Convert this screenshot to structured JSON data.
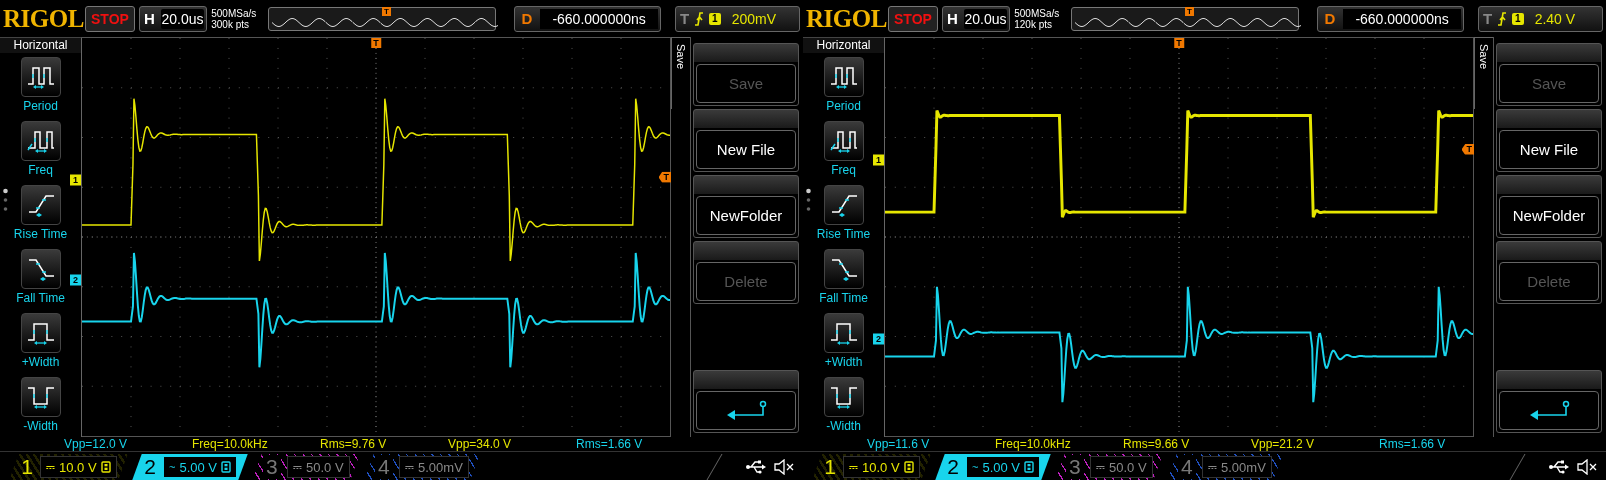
{
  "scopes": [
    {
      "logo": "RIGOL",
      "run_state": "STOP",
      "timebase": {
        "label": "H",
        "value": "20.0us"
      },
      "sample_rate": "500MSa/s",
      "memory_depth": "300k pts",
      "delay": {
        "label": "D",
        "value": "-660.000000ns"
      },
      "trigger": {
        "label": "T",
        "source": "1",
        "level": "200mV"
      },
      "sidebar": {
        "title": "Horizontal",
        "items": [
          {
            "label": "Period",
            "kind": "period"
          },
          {
            "label": "Freq",
            "kind": "freq"
          },
          {
            "label": "Rise Time",
            "kind": "rise"
          },
          {
            "label": "Fall Time",
            "kind": "fall"
          },
          {
            "label": "+Width",
            "kind": "pwidth"
          },
          {
            "label": "-Width",
            "kind": "nwidth"
          }
        ]
      },
      "trigger_markers": {
        "memory": "T",
        "position": "T",
        "level": "T"
      },
      "traces": [
        {
          "marker": "1",
          "kind": "ringing",
          "color": "#e6e600"
        },
        {
          "marker": "2",
          "kind": "spike",
          "color": "#18d4ec"
        }
      ],
      "menu": {
        "title": "Save",
        "buttons": [
          {
            "kind": "text",
            "label": "Save",
            "disabled": true
          },
          {
            "kind": "text",
            "label": "New File",
            "disabled": false
          },
          {
            "kind": "text",
            "label": "NewFolder",
            "disabled": false
          },
          {
            "kind": "text",
            "label": "Delete",
            "disabled": true
          },
          {
            "kind": "back"
          }
        ]
      },
      "measurements": [
        {
          "text": "Vpp=12.0 V",
          "color": "#18d4ec"
        },
        {
          "text": "Freq=10.0kHz",
          "color": "#e6e600"
        },
        {
          "text": "Rms=9.76 V",
          "color": "#e6e600"
        },
        {
          "text": "Vpp=34.0 V",
          "color": "#e6e600"
        },
        {
          "text": "Rms=1.66 V",
          "color": "#18d4ec"
        }
      ],
      "channels": [
        {
          "number": "1",
          "coupling": "⎓",
          "scale": "10.0 V",
          "color": "#e6e600",
          "enabled": true,
          "selected": false
        },
        {
          "number": "2",
          "coupling": "~",
          "scale": "5.00 V",
          "color": "#18d4ec",
          "enabled": true,
          "selected": true
        },
        {
          "number": "3",
          "coupling": "⎓",
          "scale": "50.0 V",
          "color": "#c020c0",
          "enabled": false,
          "selected": false
        },
        {
          "number": "4",
          "coupling": "⎓",
          "scale": "5.00mV",
          "color": "#2050c0",
          "enabled": false,
          "selected": false
        }
      ]
    },
    {
      "logo": "RIGOL",
      "run_state": "STOP",
      "timebase": {
        "label": "H",
        "value": "20.0us"
      },
      "sample_rate": "500MSa/s",
      "memory_depth": "120k pts",
      "delay": {
        "label": "D",
        "value": "-660.000000ns"
      },
      "trigger": {
        "label": "T",
        "source": "1",
        "level": "2.40 V"
      },
      "sidebar": {
        "title": "Horizontal",
        "items": [
          {
            "label": "Period",
            "kind": "period"
          },
          {
            "label": "Freq",
            "kind": "freq"
          },
          {
            "label": "Rise Time",
            "kind": "rise"
          },
          {
            "label": "Fall Time",
            "kind": "fall"
          },
          {
            "label": "+Width",
            "kind": "pwidth"
          },
          {
            "label": "-Width",
            "kind": "nwidth"
          }
        ]
      },
      "trigger_markers": {
        "memory": "T",
        "position": "T",
        "level": "T"
      },
      "traces": [
        {
          "marker": "1",
          "kind": "square",
          "color": "#e6e600"
        },
        {
          "marker": "2",
          "kind": "spike",
          "color": "#18d4ec"
        }
      ],
      "menu": {
        "title": "Save",
        "buttons": [
          {
            "kind": "text",
            "label": "Save",
            "disabled": true
          },
          {
            "kind": "text",
            "label": "New File",
            "disabled": false
          },
          {
            "kind": "text",
            "label": "NewFolder",
            "disabled": false
          },
          {
            "kind": "text",
            "label": "Delete",
            "disabled": true
          },
          {
            "kind": "back"
          }
        ]
      },
      "measurements": [
        {
          "text": "Vpp=11.6 V",
          "color": "#18d4ec"
        },
        {
          "text": "Freq=10.0kHz",
          "color": "#e6e600"
        },
        {
          "text": "Rms=9.66 V",
          "color": "#e6e600"
        },
        {
          "text": "Vpp=21.2 V",
          "color": "#e6e600"
        },
        {
          "text": "Rms=1.66 V",
          "color": "#18d4ec"
        }
      ],
      "channels": [
        {
          "number": "1",
          "coupling": "⎓",
          "scale": "10.0 V",
          "color": "#e6e600",
          "enabled": true,
          "selected": false
        },
        {
          "number": "2",
          "coupling": "~",
          "scale": "5.00 V",
          "color": "#18d4ec",
          "enabled": true,
          "selected": true
        },
        {
          "number": "3",
          "coupling": "⎓",
          "scale": "50.0 V",
          "color": "#c020c0",
          "enabled": false,
          "selected": false
        },
        {
          "number": "4",
          "coupling": "⎓",
          "scale": "5.00mV",
          "color": "#2050c0",
          "enabled": false,
          "selected": false
        }
      ]
    }
  ]
}
